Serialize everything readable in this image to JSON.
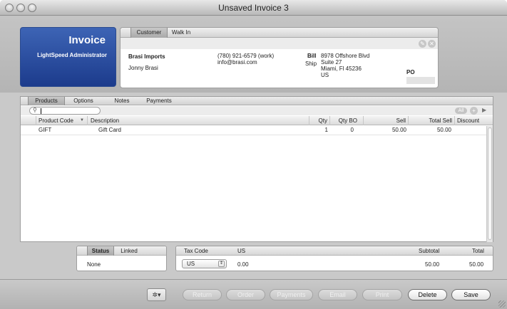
{
  "window": {
    "title": "Unsaved Invoice 3"
  },
  "badge": {
    "title": "Invoice",
    "user": "LightSpeed Administrator"
  },
  "customer_tabs": [
    {
      "label": "Customer",
      "selected": true
    },
    {
      "label": "Walk In",
      "selected": false
    }
  ],
  "customer": {
    "company": "Brasi Imports",
    "name": "Jonny Brasi",
    "phone": "(780) 921-6579 (work)",
    "email": "info@brasi.com",
    "bill_label": "Bill",
    "ship_label": "Ship",
    "address_line1": "8978 Offshore Blvd",
    "address_line2": "Suite 27",
    "address_line3": "Miami, Fl 45236",
    "address_line4": "US",
    "po_label": "PO",
    "po_value": ""
  },
  "main_tabs": [
    {
      "label": "Products",
      "selected": true
    },
    {
      "label": "Options",
      "selected": false
    },
    {
      "label": "Notes",
      "selected": false
    },
    {
      "label": "Payments",
      "selected": false
    }
  ],
  "search": {
    "value": "",
    "placeholder": ""
  },
  "toolbar_right": {
    "all_label": "All"
  },
  "columns": {
    "product_code": "Product Code",
    "description": "Description",
    "qty": "Qty",
    "qty_bo": "Qty BO",
    "sell": "Sell",
    "total_sell": "Total Sell",
    "discount": "Discount"
  },
  "rows": [
    {
      "product_code": "GIFT",
      "description": "Gift Card",
      "qty": "1",
      "qty_bo": "0",
      "sell": "50.00",
      "total_sell": "50.00",
      "discount": ""
    }
  ],
  "status_tabs": [
    {
      "label": "Status",
      "selected": true
    },
    {
      "label": "Linked",
      "selected": false
    }
  ],
  "status": {
    "value": "None"
  },
  "tax": {
    "code_label": "Tax Code",
    "country_label": "US",
    "subtotal_label": "Subtotal",
    "total_label": "Total",
    "selected_code": "US",
    "tax_amount": "0.00",
    "subtotal": "50.00",
    "total": "50.00"
  },
  "actions": {
    "return": "Return",
    "order": "Order",
    "payments": "Payments",
    "email": "Email",
    "print": "Print",
    "delete": "Delete",
    "save": "Save"
  }
}
